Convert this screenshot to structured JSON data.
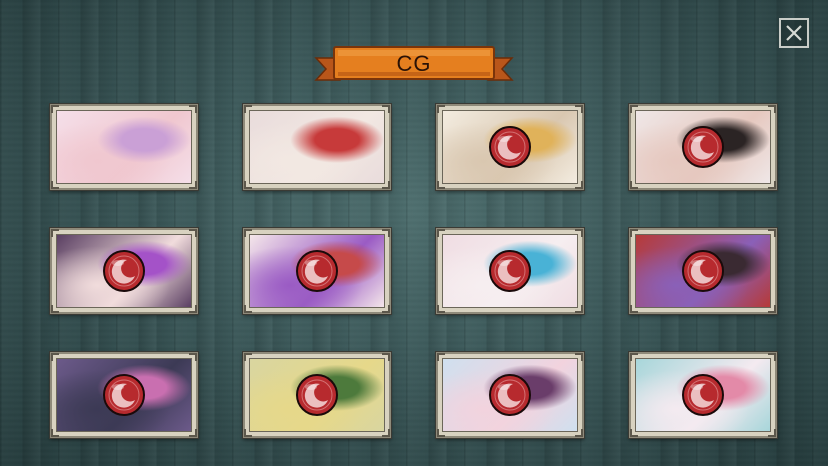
{
  "header": {
    "title": "CG",
    "close_icon": "close-icon"
  },
  "colors": {
    "banner_fill": "#e07a1c",
    "banner_edge": "#8a3b0c",
    "tile_frame": "#d8d2c0",
    "lock_badge": "#b72a2e",
    "background": "#3b5859"
  },
  "gallery": {
    "columns": 4,
    "rows": 3,
    "tiles": [
      {
        "id": "cg-1",
        "locked": false,
        "palette": [
          "#f5dfe9",
          "#caa0d6",
          "#f0c7cf"
        ]
      },
      {
        "id": "cg-2",
        "locked": false,
        "palette": [
          "#e9dcdc",
          "#c73a3a",
          "#f2e8e2"
        ]
      },
      {
        "id": "cg-3",
        "locked": true,
        "palette": [
          "#f3ece0",
          "#e0b25a",
          "#d9c7b0"
        ]
      },
      {
        "id": "cg-4",
        "locked": true,
        "palette": [
          "#efe7e7",
          "#2b2424",
          "#e6c8bf"
        ]
      },
      {
        "id": "cg-5",
        "locked": true,
        "palette": [
          "#5a3f62",
          "#a452c8",
          "#f1dcdc"
        ]
      },
      {
        "id": "cg-6",
        "locked": true,
        "palette": [
          "#f4e6ea",
          "#c64a4a",
          "#9a5bc4"
        ]
      },
      {
        "id": "cg-7",
        "locked": true,
        "palette": [
          "#f0dde3",
          "#49b2d6",
          "#f6eef0"
        ]
      },
      {
        "id": "cg-8",
        "locked": true,
        "palette": [
          "#b63a38",
          "#3a2a32",
          "#8a60b8"
        ]
      },
      {
        "id": "cg-9",
        "locked": true,
        "palette": [
          "#6c5a8a",
          "#c96fb0",
          "#3c3a55"
        ]
      },
      {
        "id": "cg-10",
        "locked": true,
        "palette": [
          "#d9d6a0",
          "#4d7a3c",
          "#e6d88a"
        ]
      },
      {
        "id": "cg-11",
        "locked": true,
        "palette": [
          "#cfe0ef",
          "#6a3d6a",
          "#f2d3de"
        ]
      },
      {
        "id": "cg-12",
        "locked": true,
        "palette": [
          "#a7d6da",
          "#e38aa8",
          "#f4eaf0"
        ]
      }
    ]
  }
}
